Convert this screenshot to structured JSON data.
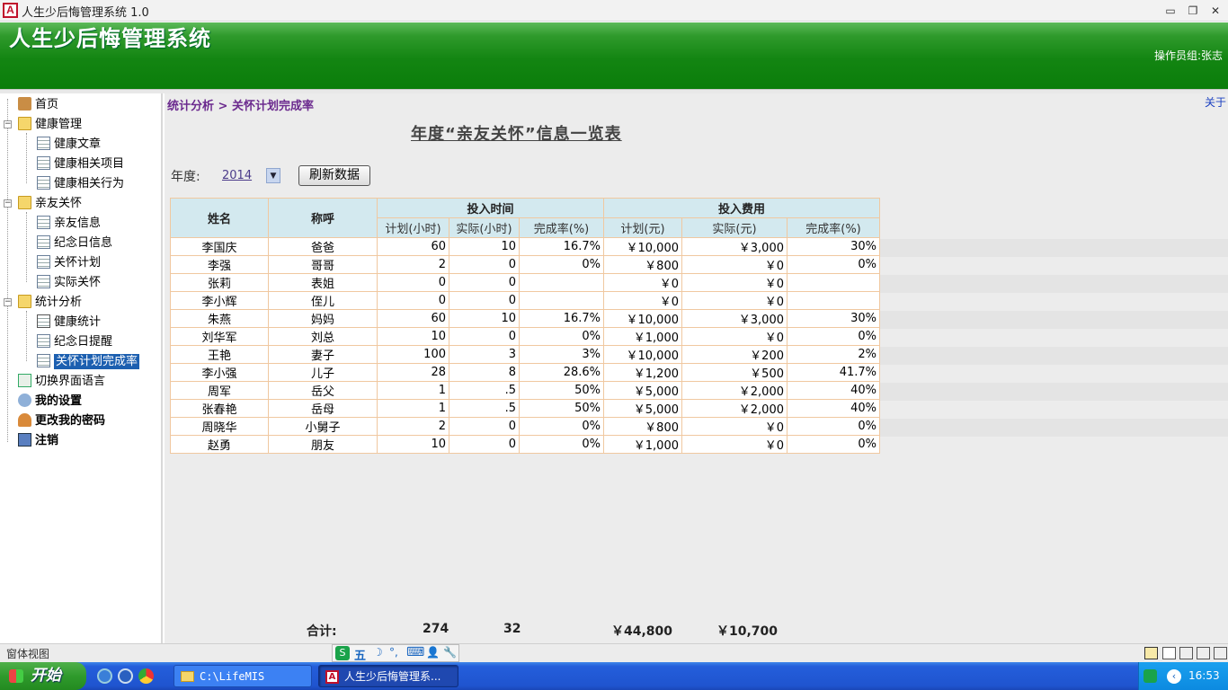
{
  "window": {
    "title": "人生少后悔管理系统 1.0",
    "icon_letter": "A"
  },
  "window_controls": {
    "minimize": "▭",
    "restore": "❐",
    "close": "✕"
  },
  "header": {
    "title": "人生少后悔管理系统",
    "operator": "操作员组:张志"
  },
  "sidebar": {
    "items": [
      {
        "label": "首页"
      },
      {
        "label": "健康管理"
      },
      {
        "label": "健康文章"
      },
      {
        "label": "健康相关项目"
      },
      {
        "label": "健康相关行为"
      },
      {
        "label": "亲友关怀"
      },
      {
        "label": "亲友信息"
      },
      {
        "label": "纪念日信息"
      },
      {
        "label": "关怀计划"
      },
      {
        "label": "实际关怀"
      },
      {
        "label": "统计分析"
      },
      {
        "label": "健康统计"
      },
      {
        "label": "纪念日提醒"
      },
      {
        "label": "关怀计划完成率"
      },
      {
        "label": "切换界面语言"
      },
      {
        "label": "我的设置"
      },
      {
        "label": "更改我的密码"
      },
      {
        "label": "注销"
      }
    ]
  },
  "breadcrumb": "统计分析 > 关怀计划完成率",
  "about": "关于",
  "report": {
    "title": "年度“亲友关怀”信息一览表",
    "year_label": "年度:",
    "year_value": "2014",
    "refresh_label": "刷新数据",
    "headers": {
      "name": "姓名",
      "relation": "称呼",
      "time_group": "投入时间",
      "cost_group": "投入费用",
      "plan_hours": "计划(小时)",
      "actual_hours": "实际(小时)",
      "time_rate": "完成率(%)",
      "plan_cost": "计划(元)",
      "actual_cost": "实际(元)",
      "cost_rate": "完成率(%)"
    },
    "rows": [
      [
        "李国庆",
        "爸爸",
        "60",
        "10",
        "16.7%",
        "￥10,000",
        "￥3,000",
        "30%"
      ],
      [
        "李强",
        "哥哥",
        "2",
        "0",
        "0%",
        "￥800",
        "￥0",
        "0%"
      ],
      [
        "张莉",
        "表姐",
        "0",
        "0",
        "",
        "￥0",
        "￥0",
        ""
      ],
      [
        "李小辉",
        "侄儿",
        "0",
        "0",
        "",
        "￥0",
        "￥0",
        ""
      ],
      [
        "朱燕",
        "妈妈",
        "60",
        "10",
        "16.7%",
        "￥10,000",
        "￥3,000",
        "30%"
      ],
      [
        "刘华军",
        "刘总",
        "10",
        "0",
        "0%",
        "￥1,000",
        "￥0",
        "0%"
      ],
      [
        "王艳",
        "妻子",
        "100",
        "3",
        "3%",
        "￥10,000",
        "￥200",
        "2%"
      ],
      [
        "李小强",
        "儿子",
        "28",
        "8",
        "28.6%",
        "￥1,200",
        "￥500",
        "41.7%"
      ],
      [
        "周军",
        "岳父",
        "1",
        ".5",
        "50%",
        "￥5,000",
        "￥2,000",
        "40%"
      ],
      [
        "张春艳",
        "岳母",
        "1",
        ".5",
        "50%",
        "￥5,000",
        "￥2,000",
        "40%"
      ],
      [
        "周晓华",
        "小舅子",
        "2",
        "0",
        "0%",
        "￥800",
        "￥0",
        "0%"
      ],
      [
        "赵勇",
        "朋友",
        "10",
        "0",
        "0%",
        "￥1,000",
        "￥0",
        "0%"
      ]
    ],
    "totals": {
      "label": "合计:",
      "plan_hours": "274",
      "actual_hours": "32",
      "plan_cost": "￥44,800",
      "actual_cost": "￥10,700"
    }
  },
  "statusbar": {
    "text": "窗体视图",
    "ime": [
      "S",
      "五",
      "☽",
      "°,",
      "⌨",
      "👤",
      "🔧"
    ]
  },
  "taskbar": {
    "start": "开始",
    "tasks": [
      {
        "label": "C:\\LifeMIS"
      },
      {
        "label": "人生少后悔管理系..."
      }
    ],
    "clock": "16:53"
  }
}
